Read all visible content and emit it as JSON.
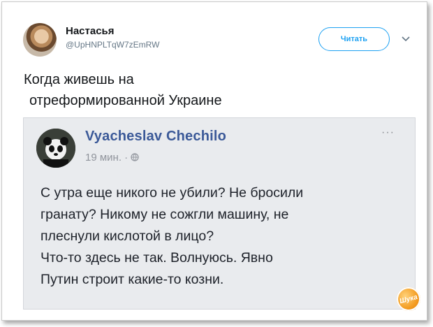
{
  "tweet": {
    "author_name": "Настасья",
    "author_handle": "@UpHNPLTqW7zEmRW",
    "follow_label": "Читать",
    "text_line1": "Когда живешь на",
    "text_line2": "отреформированной Украине"
  },
  "embedded_post": {
    "author_name": "Vyacheslav Chechilo",
    "time": "19 мин.",
    "separator": "·",
    "more_label": "···",
    "body_lines": [
      "С утра еще никого не убили? Не бросили",
      "гранату? Никому не сожгли машину, не",
      "плеснули кислотой в лицо?",
      "Что-то здесь не так. Волнуюсь. Явно",
      "Путин строит какие-то козни."
    ]
  },
  "watermark": {
    "text": "Шука"
  },
  "icons": {
    "chevron": "chevron-down-icon",
    "globe": "globe-icon"
  },
  "colors": {
    "follow": "#1da1f2",
    "fb_name": "#3b5998",
    "embed_bg": "#e9ebee"
  }
}
